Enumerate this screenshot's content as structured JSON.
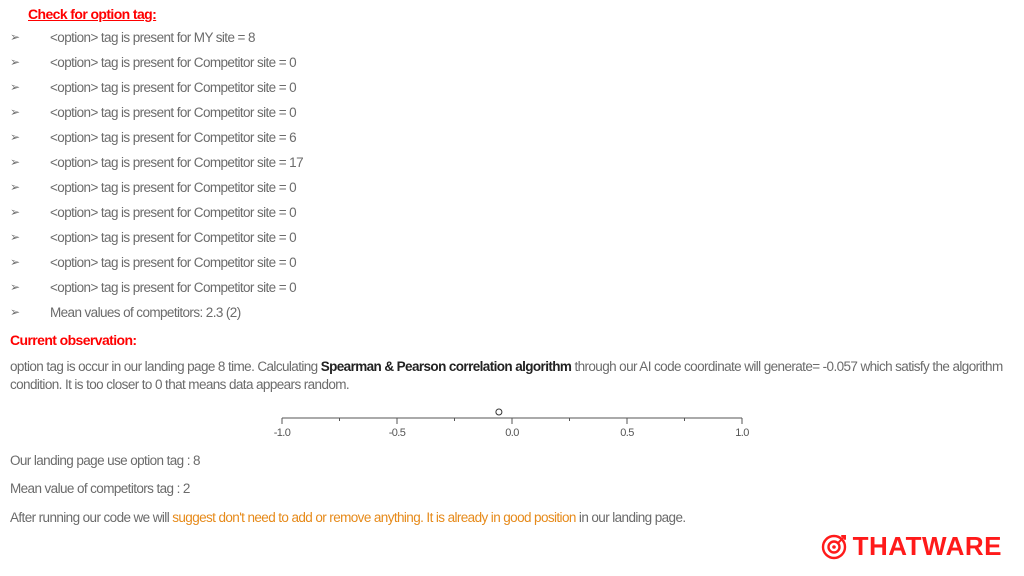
{
  "section_title": "Check for option tag:",
  "bullets": [
    "<option> tag is present for MY site =  8",
    "<option> tag is present for Competitor site = 0",
    "<option> tag is present for Competitor site = 0",
    "<option> tag is present for Competitor site = 0",
    "<option> tag is present for Competitor site = 6",
    "<option> tag is present for Competitor site = 17",
    "<option> tag is present for Competitor site = 0",
    "<option> tag is present for Competitor site = 0",
    "<option> tag is present for Competitor site = 0",
    "<option> tag is present for Competitor site = 0",
    "<option> tag is present for Competitor site = 0",
    "Mean values of competitors: 2.3 (2)"
  ],
  "observation_title": "Current observation:",
  "obs_p1_a": "option tag is occur in our landing page 8 time. Calculating ",
  "obs_p1_bold": "Spearman & Pearson correlation algorithm",
  "obs_p1_b": " through our AI code coordinate will generate= -0.057 which satisfy the algorithm condition. It is too closer to 0 that means data appears random.",
  "line_landing": "Our landing page use option tag : 8",
  "line_competitors": "Mean value of competitors tag : 2",
  "suggest_a": "After running our code we will ",
  "suggest_orange": "suggest don't need to add or remove anything. It is already in good position",
  "suggest_b": " in our landing page.",
  "chart_data": {
    "type": "scatter",
    "x": [
      -0.057
    ],
    "y": [
      0
    ],
    "xlim": [
      -1.0,
      1.0
    ],
    "xticks": [
      -1.0,
      -0.5,
      0.0,
      0.5,
      1.0
    ],
    "title": "",
    "xlabel": "",
    "ylabel": ""
  },
  "brand": "THATWARE"
}
